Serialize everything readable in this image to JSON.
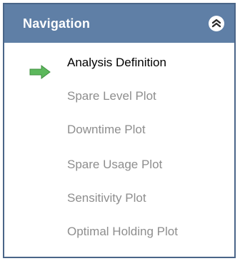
{
  "header": {
    "title": "Navigation",
    "collapse_icon": "double-chevron-up-icon"
  },
  "items": [
    {
      "label": "Analysis Definition",
      "active": true,
      "icon": "green-arrow-right-icon"
    },
    {
      "label": "Spare Level Plot",
      "active": false
    },
    {
      "label": "Downtime Plot",
      "active": false
    },
    {
      "label": "Spare Usage Plot",
      "active": false
    },
    {
      "label": "Sensitivity Plot",
      "active": false
    },
    {
      "label": "Optimal Holding Plot",
      "active": false
    }
  ],
  "colors": {
    "header_bg": "#5f7fa6",
    "border": "#4a6588",
    "active_text": "#000000",
    "inactive_text": "#8e8e8e",
    "arrow": "#5cb85c"
  }
}
